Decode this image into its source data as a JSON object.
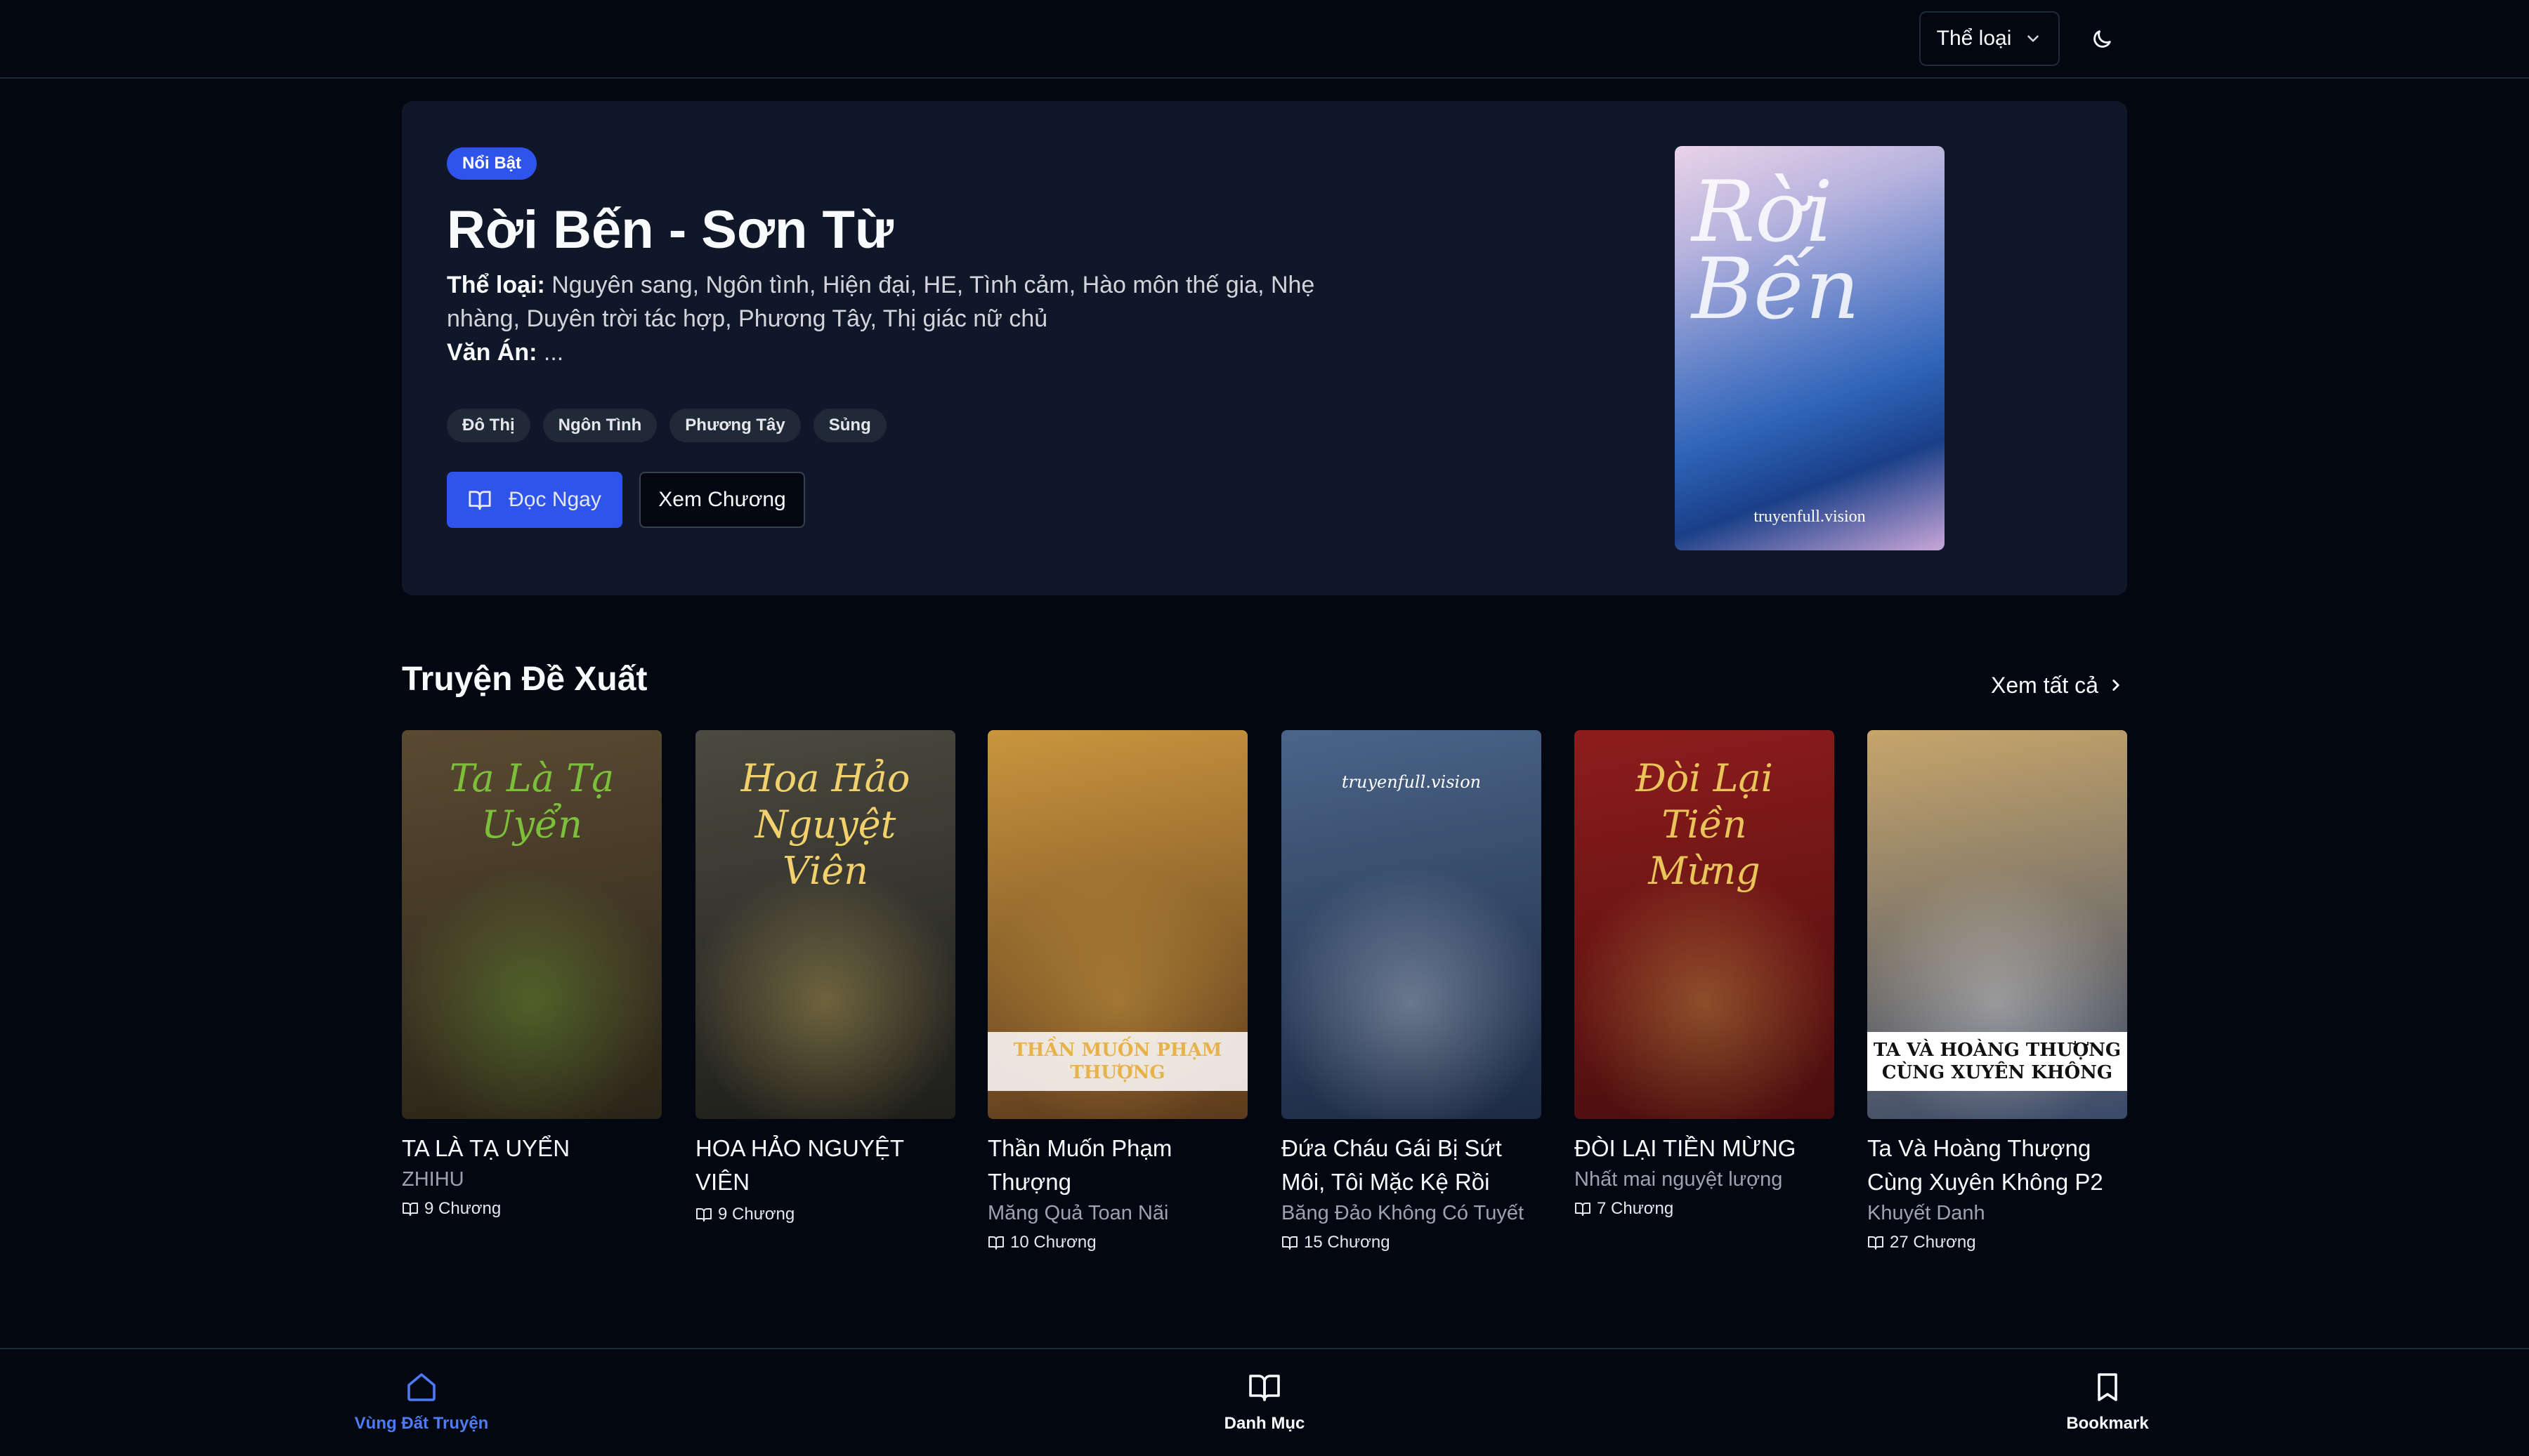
{
  "topbar": {
    "genre_label": "Thể loại",
    "genre_icon": "chevron-down-icon",
    "theme_icon": "moon-icon"
  },
  "hero": {
    "badge": "Nổi Bật",
    "title": "Rời Bến - Sơn Từ",
    "genre_label": "Thể loại:",
    "genre_text": "Nguyên sang, Ngôn tình, Hiện đại, HE, Tình cảm, Hào môn thế gia, Nhẹ nhàng, Duyên trời tác hợp, Phương Tây, Thị giác nữ chủ",
    "summary_label": "Văn Án:",
    "summary_text": "...",
    "tags": [
      "Đô Thị",
      "Ngôn Tình",
      "Phương Tây",
      "Sủng"
    ],
    "read_button": "Đọc Ngay",
    "chapters_button": "Xem Chương",
    "cover_title": "Rời Bến",
    "cover_watermark": "truyenfull.vision"
  },
  "section": {
    "title": "Truyện Đề Xuất",
    "see_all": "Xem tất cả"
  },
  "stories": [
    {
      "title": "TA LÀ TẠ UYỂN",
      "author": "ZHIHU",
      "chapters": "9 Chương",
      "cover_text": "Ta Là Tạ Uyển",
      "colors": [
        "#5a4a32",
        "#2a2418",
        "#7cbf3a"
      ]
    },
    {
      "title": "HOA HẢO NGUYỆT VIÊN",
      "author": "",
      "chapters": "9 Chương",
      "cover_text": "Hoa Hảo Nguyệt Viên",
      "colors": [
        "#4a4a40",
        "#1e1e1a",
        "#f2d06b"
      ]
    },
    {
      "title": "Thần Muốn Phạm Thượng",
      "author": "Măng Quả Toan Nãi",
      "chapters": "10 Chương",
      "cover_text": "THẦN MUỐN PHẠM THƯỢNG",
      "colors": [
        "#c9953e",
        "#5c3a1c",
        "#e8b24a"
      ]
    },
    {
      "title": "Đứa Cháu Gái Bị Sứt Môi, Tôi Mặc Kệ Rồi",
      "author": "Băng Đảo Không Có Tuyết",
      "chapters": "15 Chương",
      "cover_text": "truyenfull.vision",
      "colors": [
        "#4a6488",
        "#1c2a44",
        "#e8eef7"
      ]
    },
    {
      "title": "ĐÒI LẠI TIỀN MỪNG",
      "author": "Nhất mai nguyệt lượng",
      "chapters": "7 Chương",
      "cover_text": "Đòi Lại Tiền Mừng",
      "colors": [
        "#8e1c1c",
        "#4a0e0e",
        "#e8c45a"
      ]
    },
    {
      "title": "Ta Và Hoàng Thượng Cùng Xuyên Không P2",
      "author": "Khuyết Danh",
      "chapters": "27 Chương",
      "cover_text": "TA VÀ HOÀNG THƯỢNG CÙNG XUYÊN KHÔNG",
      "colors": [
        "#c7a56a",
        "#3a4a6a",
        "#ffffff"
      ]
    }
  ],
  "bottomnav": [
    {
      "label": "Vùng Đất Truyện",
      "icon": "home-icon",
      "active": true
    },
    {
      "label": "Danh Mục",
      "icon": "book-open-icon",
      "active": false
    },
    {
      "label": "Bookmark",
      "icon": "bookmark-icon",
      "active": false
    }
  ],
  "colors": {
    "background": "#030712",
    "accent": "#2f54eb",
    "hero_bg": "#0f1729",
    "nav_active": "#4c7bf4"
  }
}
